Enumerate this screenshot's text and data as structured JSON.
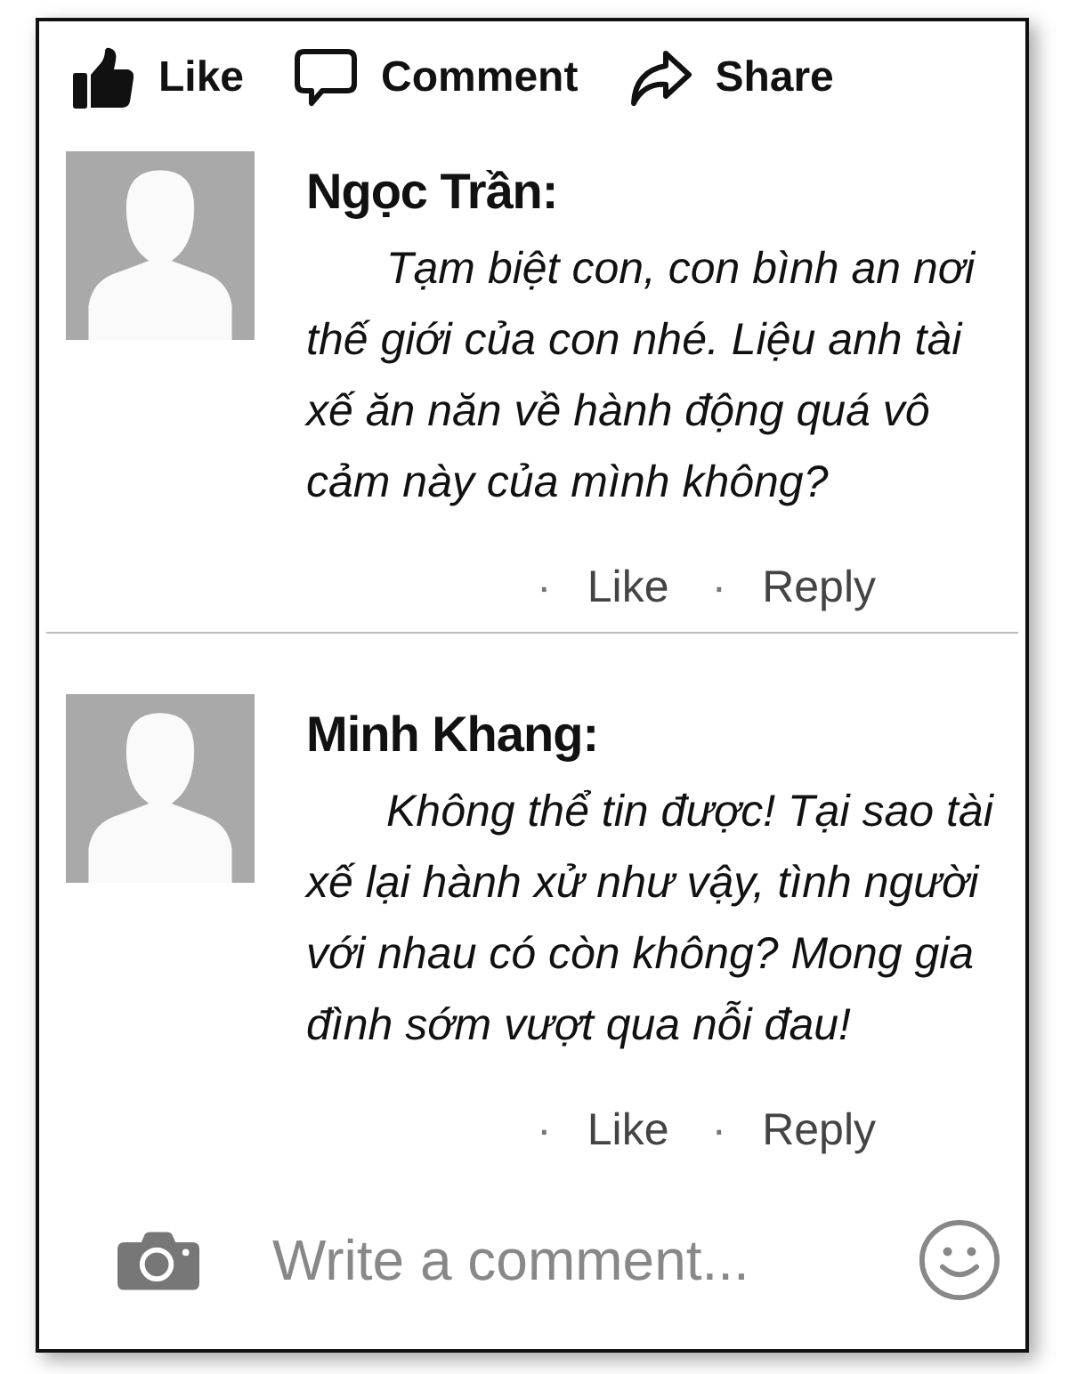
{
  "action_bar": [
    {
      "kind": "like",
      "label": "Like"
    },
    {
      "kind": "comment",
      "label": "Comment"
    },
    {
      "kind": "share",
      "label": "Share"
    }
  ],
  "comments": [
    {
      "name": "Ngọc Trần:",
      "text": "Tạm biệt con, con bình an nơi thế giới của con nhé. Liệu anh tài xế ăn năn về hành động quá vô cảm này của mình không?",
      "like": {
        "bullet": "·",
        "label": "Like"
      },
      "reply": {
        "bullet": "·",
        "label": "Reply"
      }
    },
    {
      "name": "Minh Khang:",
      "text": "Không thể tin được! Tại sao tài xế lại hành xử như vậy, tình người với nhau có còn không? Mong gia đình sớm vượt qua nỗi đau!",
      "like": {
        "bullet": "·",
        "label": "Like"
      },
      "reply": {
        "bullet": "·",
        "label": "Reply"
      }
    }
  ],
  "composer": {
    "placeholder": "Write a comment..."
  }
}
